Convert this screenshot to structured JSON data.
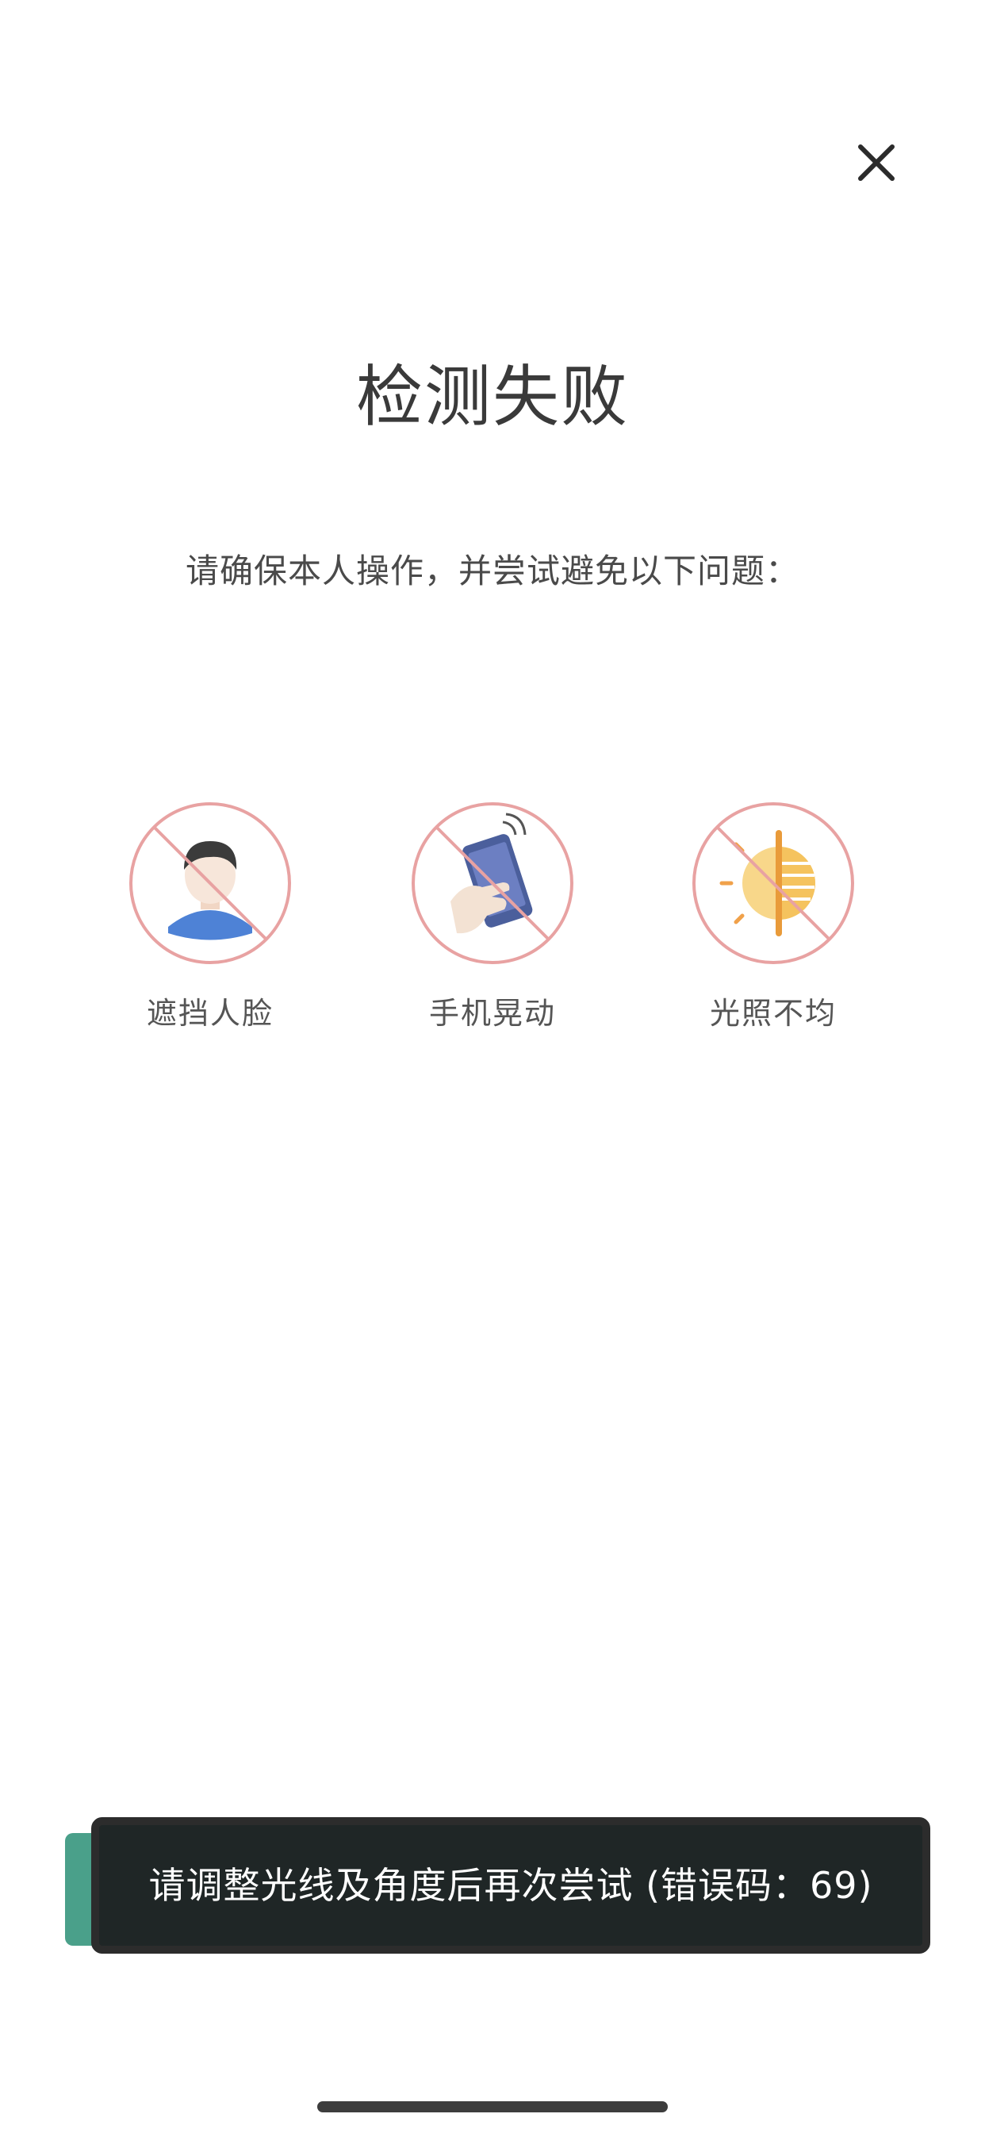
{
  "header": {
    "close_icon": "close-icon"
  },
  "main": {
    "title": "检测失败",
    "subtitle": "请确保本人操作，并尝试避免以下问题："
  },
  "tips": [
    {
      "icon": "face-blocked-icon",
      "label": "遮挡人脸"
    },
    {
      "icon": "phone-shaking-icon",
      "label": "手机晃动"
    },
    {
      "icon": "uneven-light-icon",
      "label": "光照不均"
    }
  ],
  "toast": {
    "message": "请调整光线及角度后再次尝试 (错误码：69)"
  },
  "colors": {
    "prohibit_ring": "#e8a2a2",
    "toast_bg": "#1f2626",
    "toast_accent": "#4aa08a",
    "text_primary": "#3a3a3a"
  }
}
